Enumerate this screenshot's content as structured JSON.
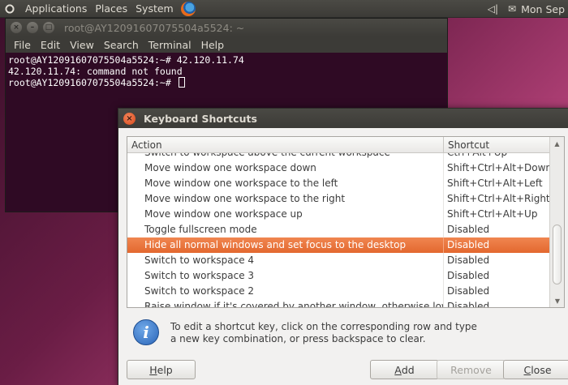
{
  "panel": {
    "menus": [
      "Applications",
      "Places",
      "System"
    ],
    "clock": "Mon Sep"
  },
  "terminal": {
    "title": "root@AY12091607075504a5524: ~",
    "menus": [
      "File",
      "Edit",
      "View",
      "Search",
      "Terminal",
      "Help"
    ],
    "lines": [
      "root@AY12091607075504a5524:~# 42.120.11.74",
      "42.120.11.74: command not found",
      "root@AY12091607075504a5524:~# "
    ]
  },
  "dialog": {
    "title": "Keyboard Shortcuts",
    "columns": {
      "action": "Action",
      "shortcut": "Shortcut"
    },
    "rows": [
      {
        "action": "Switch to workspace above the current workspace",
        "shortcut": "Ctrl+Alt+Up"
      },
      {
        "action": "Move window one workspace down",
        "shortcut": "Shift+Ctrl+Alt+Down"
      },
      {
        "action": "Move window one workspace to the left",
        "shortcut": "Shift+Ctrl+Alt+Left"
      },
      {
        "action": "Move window one workspace to the right",
        "shortcut": "Shift+Ctrl+Alt+Right"
      },
      {
        "action": "Move window one workspace up",
        "shortcut": "Shift+Ctrl+Alt+Up"
      },
      {
        "action": "Toggle fullscreen mode",
        "shortcut": "Disabled"
      },
      {
        "action": "Hide all normal windows and set focus to the desktop",
        "shortcut": "Disabled",
        "selected": true
      },
      {
        "action": "Switch to workspace 4",
        "shortcut": "Disabled"
      },
      {
        "action": "Switch to workspace 3",
        "shortcut": "Disabled"
      },
      {
        "action": "Switch to workspace 2",
        "shortcut": "Disabled"
      },
      {
        "action": "Raise window if it's covered by another window, otherwise lower it",
        "shortcut": "Disabled"
      }
    ],
    "info_text": "To edit a shortcut key, click on the corresponding row and type a new key combination, or press backspace to clear.",
    "buttons": {
      "help": {
        "mnemonic": "H",
        "rest": "elp"
      },
      "add": {
        "mnemonic": "A",
        "rest": "dd"
      },
      "remove": "Remove",
      "close": {
        "mnemonic": "C",
        "rest": "lose"
      }
    }
  }
}
